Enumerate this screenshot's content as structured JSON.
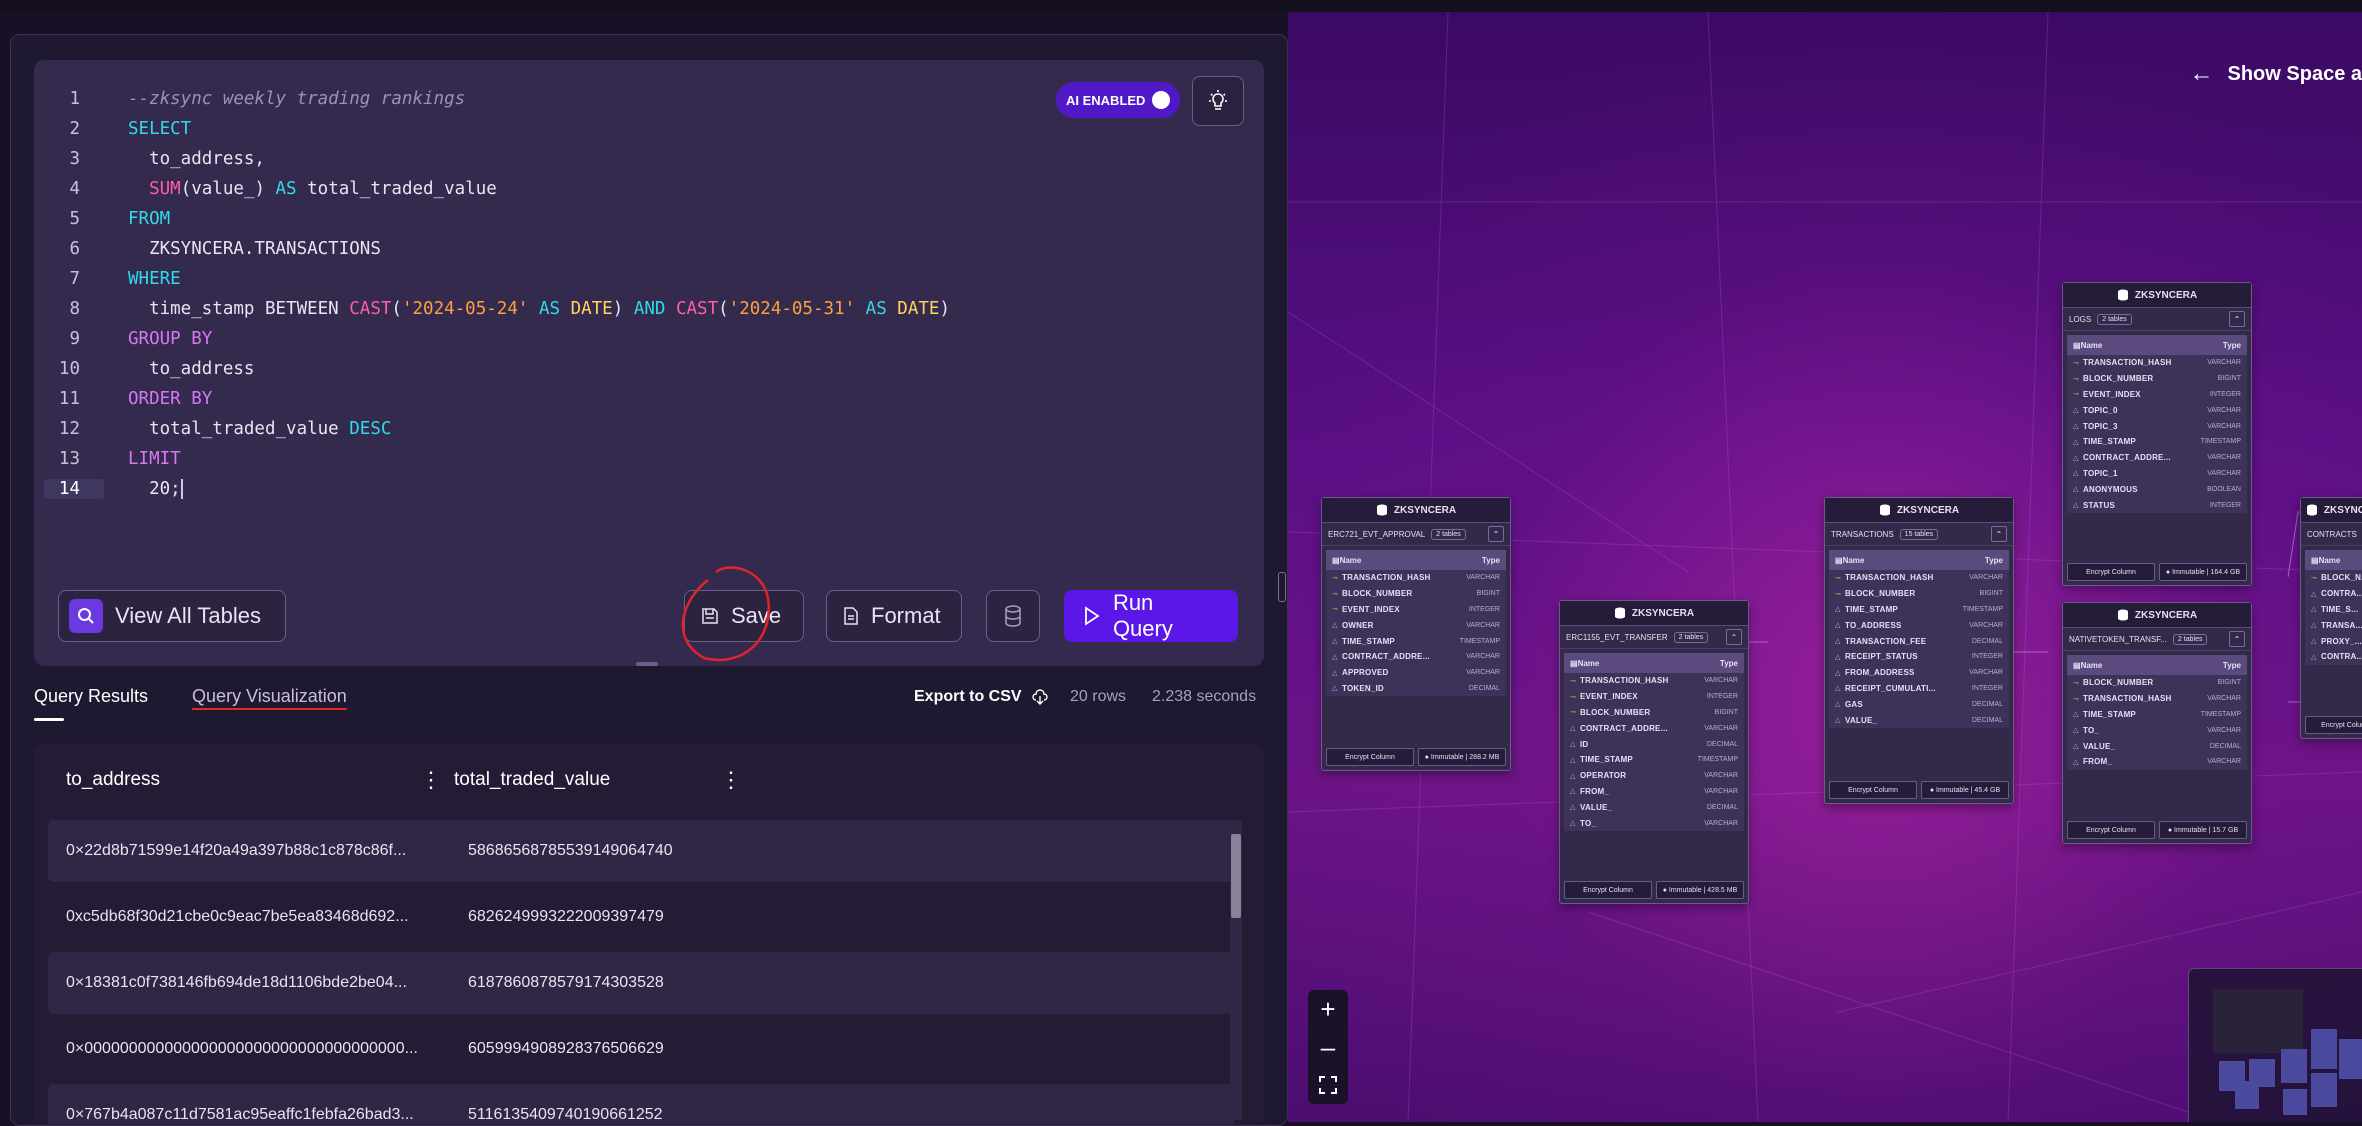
{
  "editor": {
    "ai_label": "AI ENABLED",
    "lines": [
      {
        "n": "1",
        "html": "<span class=\"cm\">--zksync weekly trading rankings</span>"
      },
      {
        "n": "2",
        "html": "<span class=\"kw\">SELECT</span>"
      },
      {
        "n": "3",
        "html": "  to_address,"
      },
      {
        "n": "4",
        "html": "  <span class=\"fn\">SUM</span>(value_) <span class=\"kw\">AS</span> total_traded_value"
      },
      {
        "n": "5",
        "html": "<span class=\"kw\">FROM</span>"
      },
      {
        "n": "6",
        "html": "  ZKSYNCERA.TRANSACTIONS"
      },
      {
        "n": "7",
        "html": "<span class=\"kw\">WHERE</span>"
      },
      {
        "n": "8",
        "html": "  time_stamp BETWEEN <span class=\"fn\">CAST</span>(<span class=\"str\">'2024-05-24'</span> <span class=\"kw\">AS</span> <span class=\"ty\">DATE</span>) <span class=\"kw\">AND</span> <span class=\"fn\">CAST</span>(<span class=\"str\">'2024-05-31'</span> <span class=\"kw\">AS</span> <span class=\"ty\">DATE</span>)"
      },
      {
        "n": "9",
        "html": "<span class=\"kw2\">GROUP BY</span>"
      },
      {
        "n": "10",
        "html": "  to_address"
      },
      {
        "n": "11",
        "html": "<span class=\"kw2\">ORDER BY</span>"
      },
      {
        "n": "12",
        "html": "  total_traded_value <span class=\"kw\">DESC</span>"
      },
      {
        "n": "13",
        "html": "<span class=\"kw2\">LIMIT</span>"
      },
      {
        "n": "14",
        "html": "  20;<span class=\"cursor\"></span>",
        "active": true
      }
    ],
    "view_tables_label": "View All Tables",
    "save_label": "Save",
    "format_label": "Format",
    "run_label": "Run Query"
  },
  "results": {
    "tab_results": "Query Results",
    "tab_viz": "Query Visualization",
    "export_label": "Export to CSV",
    "rows_count": "20 rows",
    "duration": "2.238 seconds",
    "columns": [
      "to_address",
      "total_traded_value"
    ],
    "rows": [
      [
        "0×22d8b71599e14f20a49a397b88c1c878c86f...",
        "5868656878553914906474​0"
      ],
      [
        "0xc5db68f30d21cbe0c9eac7be5ea83468d692...",
        "6826249993222009397479"
      ],
      [
        "0×18381c0f738146fb694de18d1106bde2be04...",
        "6187860878579174303528"
      ],
      [
        "0×000000000000000000000000000000000000...",
        "6059994908928376506629"
      ],
      [
        "0×767b4a087c11d7581ac95eaffc1febfa26bad3...",
        "5116135409740190661252"
      ]
    ]
  },
  "canvas": {
    "show_space_label": "Show Space a",
    "tables": [
      {
        "db": "ZKSYNCERA",
        "name": "ERC721_EVT_APPROVAL",
        "badge": "2 tables",
        "cols": [
          [
            "TRANSACTION_HASH",
            "VARCHAR",
            "k"
          ],
          [
            "BLOCK_NUMBER",
            "BIGINT",
            "k"
          ],
          [
            "EVENT_INDEX",
            "INTEGER",
            "k"
          ],
          [
            "OWNER",
            "VARCHAR",
            "t"
          ],
          [
            "TIME_STAMP",
            "TIMESTAMP",
            "t"
          ],
          [
            "CONTRACT_ADDRE...",
            "VARCHAR",
            "t"
          ],
          [
            "APPROVED",
            "VARCHAR",
            "t"
          ],
          [
            "TOKEN_ID",
            "DECIMAL",
            "t"
          ]
        ],
        "imm": "Immutable | 288.2 MB"
      },
      {
        "db": "ZKSYNCERA",
        "name": "ERC1155_EVT_TRANSFER",
        "badge": "2 tables",
        "cols": [
          [
            "TRANSACTION_HASH",
            "VARCHAR",
            "k"
          ],
          [
            "EVENT_INDEX",
            "INTEGER",
            "k"
          ],
          [
            "BLOCK_NUMBER",
            "BIGINT",
            "k"
          ],
          [
            "CONTRACT_ADDRE...",
            "VARCHAR",
            "t"
          ],
          [
            "ID",
            "DECIMAL",
            "t"
          ],
          [
            "TIME_STAMP",
            "TIMESTAMP",
            "t"
          ],
          [
            "OPERATOR",
            "VARCHAR",
            "t"
          ],
          [
            "FROM_",
            "VARCHAR",
            "t"
          ],
          [
            "VALUE_",
            "DECIMAL",
            "t"
          ],
          [
            "TO_",
            "VARCHAR",
            "t"
          ]
        ],
        "imm": "Immutable | 428.5 MB"
      },
      {
        "db": "ZKSYNCERA",
        "name": "TRANSACTIONS",
        "badge": "15 tables",
        "cols": [
          [
            "TRANSACTION_HASH",
            "VARCHAR",
            "k"
          ],
          [
            "BLOCK_NUMBER",
            "BIGINT",
            "k"
          ],
          [
            "TIME_STAMP",
            "TIMESTAMP",
            "t"
          ],
          [
            "TO_ADDRESS",
            "VARCHAR",
            "t"
          ],
          [
            "TRANSACTION_FEE",
            "DECIMAL",
            "t"
          ],
          [
            "RECEIPT_STATUS",
            "INTEGER",
            "t"
          ],
          [
            "FROM_ADDRESS",
            "VARCHAR",
            "t"
          ],
          [
            "RECEIPT_CUMULATI...",
            "INTEGER",
            "t"
          ],
          [
            "GAS",
            "DECIMAL",
            "t"
          ],
          [
            "VALUE_",
            "DECIMAL",
            "t"
          ]
        ],
        "imm": "Immutable | 45.4 GB"
      },
      {
        "db": "ZKSYNCERA",
        "name": "LOGS",
        "badge": "2 tables",
        "cols": [
          [
            "TRANSACTION_HASH",
            "VARCHAR",
            "k"
          ],
          [
            "BLOCK_NUMBER",
            "BIGINT",
            "k"
          ],
          [
            "EVENT_INDEX",
            "INTEGER",
            "k"
          ],
          [
            "TOPIC_0",
            "VARCHAR",
            "t"
          ],
          [
            "TOPIC_3",
            "VARCHAR",
            "t"
          ],
          [
            "TIME_STAMP",
            "TIMESTAMP",
            "t"
          ],
          [
            "CONTRACT_ADDRE...",
            "VARCHAR",
            "t"
          ],
          [
            "TOPIC_1",
            "VARCHAR",
            "t"
          ],
          [
            "ANONYMOUS",
            "BOOLEAN",
            "t"
          ],
          [
            "STATUS",
            "INTEGER",
            "t"
          ]
        ],
        "imm": "Immutable | 164.4 GB"
      },
      {
        "db": "ZKSYNCERA",
        "name": "NATIVETOKEN_TRANSF...",
        "badge": "2 tables",
        "cols": [
          [
            "BLOCK_NUMBER",
            "BIGINT",
            "k"
          ],
          [
            "TRANSACTION_HASH",
            "VARCHAR",
            "k"
          ],
          [
            "TIME_STAMP",
            "TIMESTAMP",
            "t"
          ],
          [
            "TO_",
            "VARCHAR",
            "t"
          ],
          [
            "VALUE_",
            "DECIMAL",
            "t"
          ],
          [
            "FROM_",
            "VARCHAR",
            "t"
          ]
        ],
        "imm": "Immutable | 15.7 GB"
      },
      {
        "db": "ZKSYNCERA",
        "name": "CONTRACTS",
        "badge": "",
        "cols": [
          [
            "BLOCK_N...",
            "",
            "k"
          ],
          [
            "CONTRA...",
            "",
            "t"
          ],
          [
            "TIME_S...",
            "",
            "t"
          ],
          [
            "TRANSA...",
            "",
            "t"
          ],
          [
            "PROXY_...",
            "",
            "t"
          ],
          [
            "CONTRA...",
            "",
            "t"
          ]
        ],
        "imm": ""
      }
    ],
    "encrypt_label": "Encrypt Column",
    "name_header": "Name",
    "type_header": "Type"
  }
}
